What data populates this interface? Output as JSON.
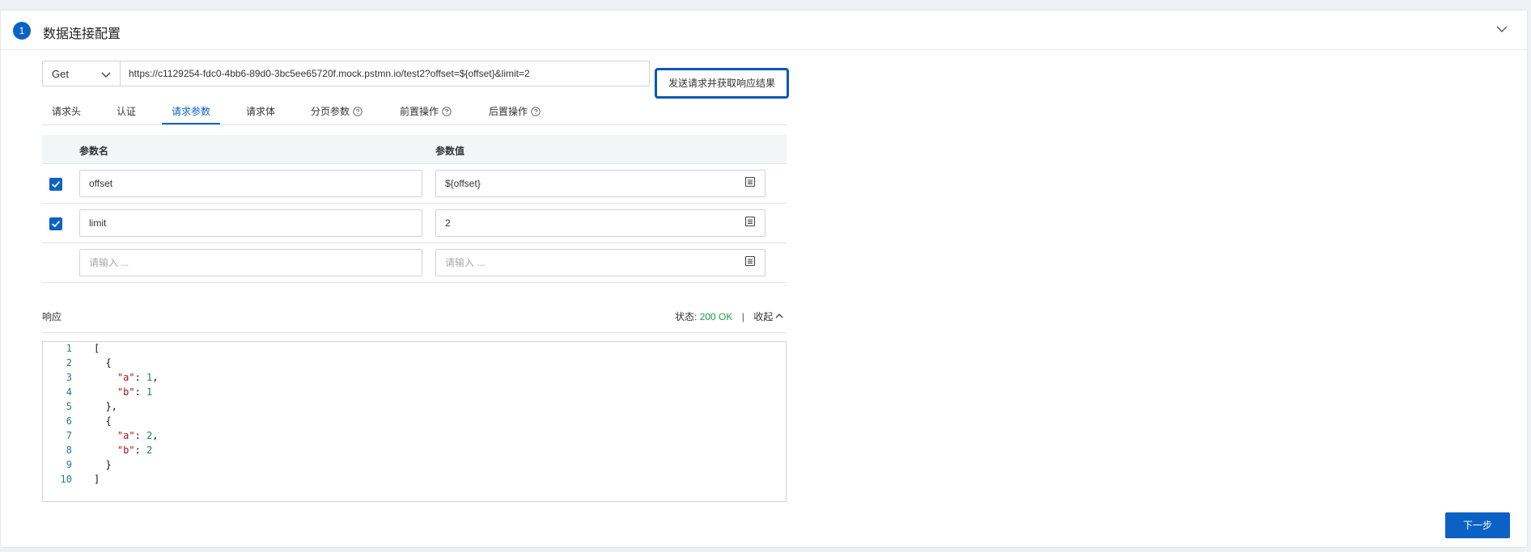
{
  "section": {
    "step_number": "1",
    "title": "数据连接配置"
  },
  "request": {
    "method": "Get",
    "url": "https://c1129254-fdc0-4bb6-89d0-3bc5ee65720f.mock.pstmn.io/test2?offset=${offset}&limit=2",
    "send_label": "发送请求并获取响应结果"
  },
  "tabs": [
    {
      "label": "请求头",
      "active": false
    },
    {
      "label": "认证",
      "active": false
    },
    {
      "label": "请求参数",
      "active": true
    },
    {
      "label": "请求体",
      "active": false
    },
    {
      "label": "分页参数",
      "active": false
    },
    {
      "label": "前置操作",
      "active": false
    },
    {
      "label": "后置操作",
      "active": false
    }
  ],
  "params_table": {
    "headers": {
      "name": "参数名",
      "value": "参数值"
    },
    "rows": [
      {
        "checked": true,
        "name": "offset",
        "value": "${offset}"
      },
      {
        "checked": true,
        "name": "limit",
        "value": "2"
      }
    ],
    "empty_row": {
      "name_placeholder": "请输入 ...",
      "value_placeholder": "请输入 ..."
    }
  },
  "response": {
    "label": "响应",
    "status_label": "状态:",
    "status_code": "200 OK",
    "separator": "|",
    "collapse_label": "收起",
    "code_lines": [
      "[",
      "  {",
      "    \"a\": 1,",
      "    \"b\": 1",
      "  },",
      "  {",
      "    \"a\": 2,",
      "    \"b\": 2",
      "  }",
      "]"
    ]
  },
  "footer": {
    "next_label": "下一步"
  },
  "colors": {
    "accent": "#0b62c4",
    "status_ok": "#1a9d4f",
    "json_key": "#a31515",
    "json_number": "#098658",
    "line_number": "#237893"
  },
  "icons": {
    "collapse": "chevron-down-icon",
    "method_dropdown": "chevron-down-icon",
    "help": "question-circle-icon",
    "value_editor": "editor-icon",
    "collapse_response": "chevron-up-icon",
    "checkbox": "check-icon"
  }
}
